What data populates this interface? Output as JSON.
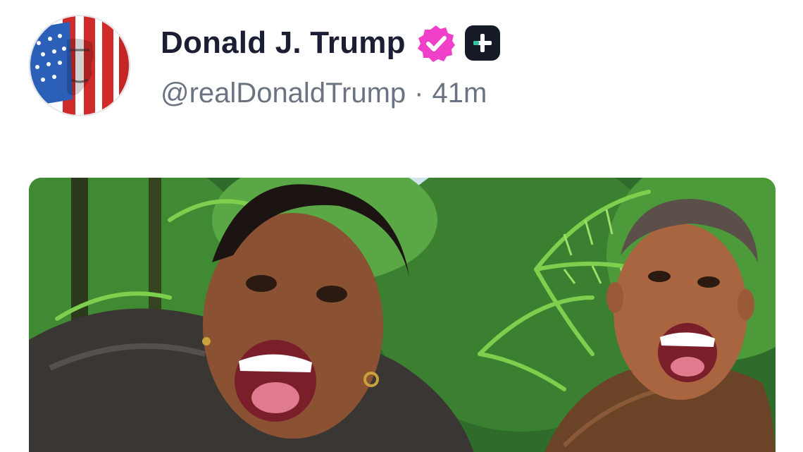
{
  "post": {
    "author": {
      "display_name": "Donald J. Trump",
      "handle": "@realDonaldTrump",
      "avatar_icon": "flag-face-avatar",
      "verified_icon": "verified-badge-icon",
      "verified_color": "#f03fc8",
      "subscribe_icon": "plus-square-icon"
    },
    "separator": "·",
    "time_ago": "41m",
    "media": {
      "type": "image",
      "scene": "jungle-illustration"
    }
  },
  "colors": {
    "name_text": "#1c1f33",
    "meta_text": "#6b7382",
    "badge_pink": "#f03fc8",
    "plus_box": "#151a26",
    "plus_accent": "#33c3a0"
  }
}
